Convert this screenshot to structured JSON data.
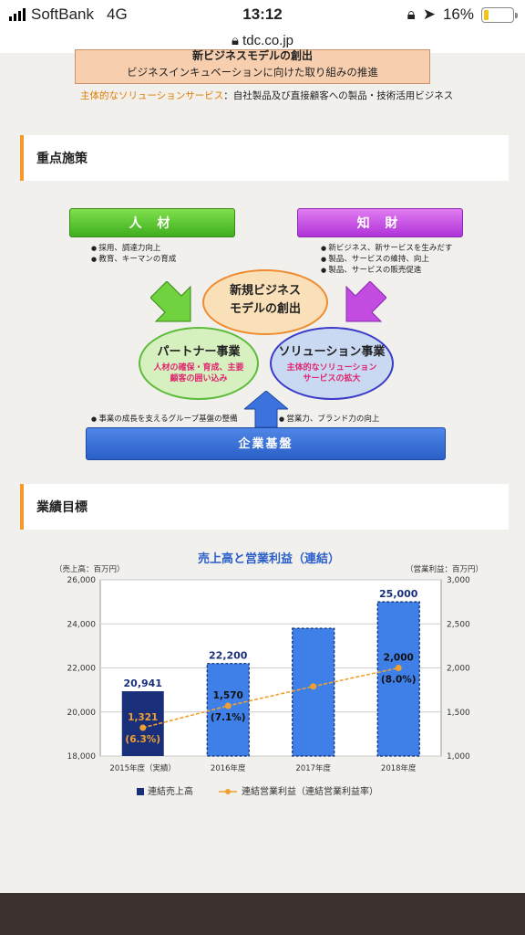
{
  "status": {
    "carrier": "SoftBank",
    "network": "4G",
    "time": "13:12",
    "battery": "16%",
    "battery_level": 0.16
  },
  "browser": {
    "url": "tdc.co.jp"
  },
  "intro": {
    "title": "新ビジネスモデルの創出",
    "subtitle": "ビジネスインキュベーションに向けた取り組みの推進",
    "solution_label": "主体的なソリューションサービス",
    "solution_text": "：自社製品及び直接顧客への製品・技術活用ビジネス"
  },
  "sections": {
    "focus": "重点施策",
    "targets": "業績目標"
  },
  "diagram": {
    "hr": {
      "label": "人 材",
      "bullets": [
        "採用、調達力向上",
        "教育、キーマンの育成"
      ]
    },
    "ip": {
      "label": "知 財",
      "bullets": [
        "新ビジネス、新サービスを生みだす",
        "製品、サービスの維持、向上",
        "製品、サービスの販売促進"
      ]
    },
    "center": {
      "line1": "新規ビジネス",
      "line2": "モデルの創出"
    },
    "partner": {
      "title": "パートナー事業",
      "line1": "人材の確保・育成、主要",
      "line2": "顧客の囲い込み"
    },
    "solution": {
      "title": "ソリューション事業",
      "line1": "主体的なソリューション",
      "line2": "サービスの拡大"
    },
    "base_note_left": "事業の成長を支えるグループ基盤の整備",
    "base_note_right": "営業力、ブランド力の向上",
    "base": "企業基盤"
  },
  "chart_data": {
    "type": "bar",
    "title": "売上高と営業利益（連結）",
    "ylabel": "（売上高：百万円）",
    "y2label": "（営業利益：百万円）",
    "categories": [
      "2015年度（実績）",
      "2016年度",
      "2017年度",
      "2018年度"
    ],
    "ylim": [
      18000,
      26000
    ],
    "y2lim": [
      1000,
      3000
    ],
    "yticks": [
      "18,000",
      "20,000",
      "22,000",
      "24,000",
      "26,000"
    ],
    "y2ticks": [
      "1,000",
      "1,500",
      "2,000",
      "2,500",
      "3,000"
    ],
    "series": [
      {
        "name": "連結売上高",
        "type": "bar",
        "values": [
          20941,
          22200,
          23800,
          25000
        ],
        "labels": [
          "20,941",
          "22,200",
          "",
          "25,000"
        ]
      },
      {
        "name": "連結営業利益（連結営業利益率）",
        "type": "line",
        "axis": "right",
        "values": [
          1321,
          1570,
          1790,
          2000
        ],
        "labels": [
          "1,321",
          "1,570",
          "",
          "2,000"
        ],
        "rates": [
          "(6.3%)",
          "(7.1%)",
          "",
          "(8.0%)"
        ]
      }
    ],
    "colors": {
      "actual": "#1a2f7a",
      "plan": "#3f7fe8",
      "line": "#f0a030"
    },
    "legend": "bottom",
    "grid": true
  }
}
